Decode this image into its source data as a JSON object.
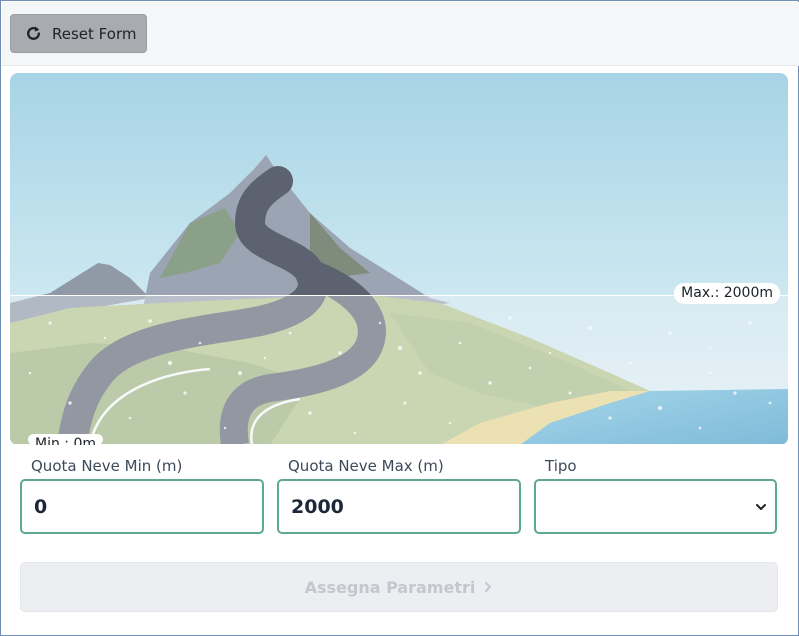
{
  "toolbar": {
    "reset_label": "Reset Form",
    "reset_icon": "refresh-icon"
  },
  "scene": {
    "max_label": "Max.: 2000m",
    "min_label": "Min.: 0m"
  },
  "form": {
    "min_label": "Quota Neve Min (m)",
    "min_value": "0",
    "max_label": "Quota Neve Max (m)",
    "max_value": "2000",
    "type_label": "Tipo",
    "type_value": "",
    "submit_label": "Assegna Parametri",
    "submit_icon": "chevron-right-icon"
  },
  "colors": {
    "input_border": "#5ea88e",
    "reset_bg": "#a8abaf",
    "sky_top": "#a7d4e5",
    "sea": "#4aa6d0"
  }
}
